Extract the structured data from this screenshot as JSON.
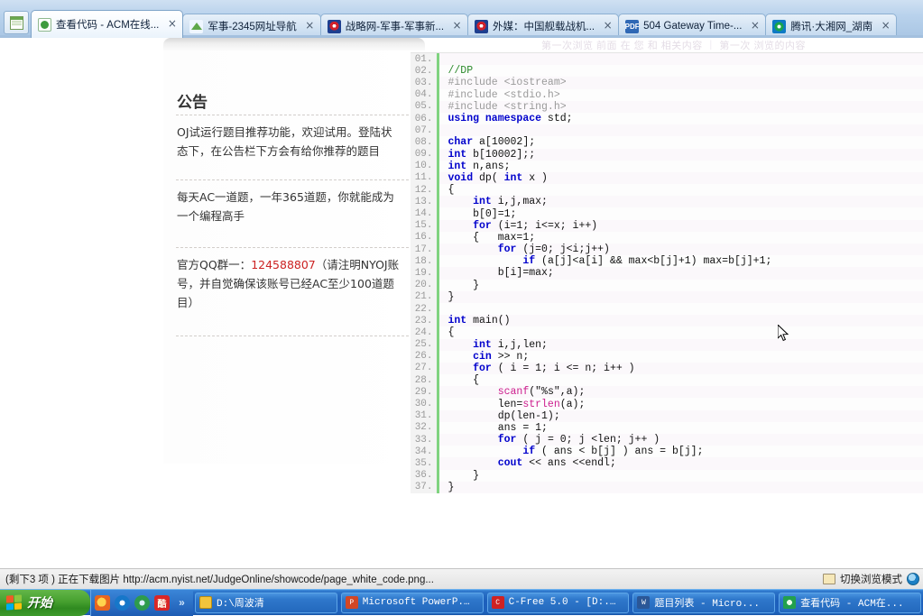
{
  "browser": {
    "window_icon": "window-restore-icon",
    "tabs": [
      {
        "label": "查看代码 - ACM在线...",
        "favicon": "acm-green-icon",
        "close": "×",
        "active": true
      },
      {
        "label": "军事-2345网址导航",
        "favicon": "2345-nav-icon",
        "close": "×",
        "active": false
      },
      {
        "label": "战略网-军事-军事新...",
        "favicon": "red-target-icon",
        "close": "×",
        "active": false
      },
      {
        "label": "外媒：中国舰载战机...",
        "favicon": "red-target-icon",
        "close": "×",
        "active": false
      },
      {
        "label": "504 Gateway Time-...",
        "favicon": "pdf-icon",
        "close": "×",
        "active": false
      },
      {
        "label": "腾讯·大湘网_湖南",
        "favicon": "qq-icon",
        "close": "×",
        "active": false
      }
    ]
  },
  "page": {
    "faint_header": "第一次浏览  前面 在 您 和 相关内容 ｜ 第一次 浏览的内容",
    "announcement": {
      "title": "公告",
      "blocks": [
        "OJ试运行题目推荐功能，欢迎试用。登陆状态下，在公告栏下方会有给你推荐的题目",
        "每天AC一道题，一年365道题，你就能成为一个编程高手"
      ],
      "qq_prefix": "官方QQ群一：",
      "qq_number": "124588807",
      "qq_suffix": "（请注明NYOJ账号，并自觉确保该账号已经AC至少100道题目）",
      "qq_number_color": "#cc2222"
    },
    "code_viewer": {
      "line_number_suffix": ".",
      "lines": [
        {
          "n": "01",
          "tokens": []
        },
        {
          "n": "02",
          "tokens": [
            {
              "t": "//DP",
              "c": "cm"
            }
          ]
        },
        {
          "n": "03",
          "tokens": [
            {
              "t": "#include <iostream>",
              "c": "pp"
            }
          ]
        },
        {
          "n": "04",
          "tokens": [
            {
              "t": "#include <stdio.h>",
              "c": "pp"
            }
          ]
        },
        {
          "n": "05",
          "tokens": [
            {
              "t": "#include <string.h>",
              "c": "pp"
            }
          ]
        },
        {
          "n": "06",
          "tokens": [
            {
              "t": "using namespace",
              "c": "k"
            },
            {
              "t": " std;",
              "c": ""
            }
          ]
        },
        {
          "n": "07",
          "tokens": []
        },
        {
          "n": "08",
          "tokens": [
            {
              "t": "char",
              "c": "k"
            },
            {
              "t": " a[10002];",
              "c": ""
            }
          ]
        },
        {
          "n": "09",
          "tokens": [
            {
              "t": "int",
              "c": "k"
            },
            {
              "t": " b[10002];;",
              "c": ""
            }
          ]
        },
        {
          "n": "10",
          "tokens": [
            {
              "t": "int",
              "c": "k"
            },
            {
              "t": " n,ans;",
              "c": ""
            }
          ]
        },
        {
          "n": "11",
          "tokens": [
            {
              "t": "void",
              "c": "k"
            },
            {
              "t": " dp( ",
              "c": ""
            },
            {
              "t": "int",
              "c": "k"
            },
            {
              "t": " x )",
              "c": ""
            }
          ]
        },
        {
          "n": "12",
          "tokens": [
            {
              "t": "{",
              "c": ""
            }
          ]
        },
        {
          "n": "13",
          "tokens": [
            {
              "t": "    ",
              "c": ""
            },
            {
              "t": "int",
              "c": "k"
            },
            {
              "t": " i,j,max;",
              "c": ""
            }
          ]
        },
        {
          "n": "14",
          "tokens": [
            {
              "t": "    b[0]=1;",
              "c": ""
            }
          ]
        },
        {
          "n": "15",
          "tokens": [
            {
              "t": "    ",
              "c": ""
            },
            {
              "t": "for",
              "c": "k"
            },
            {
              "t": " (i=1; i<=x; i++)",
              "c": ""
            }
          ]
        },
        {
          "n": "16",
          "tokens": [
            {
              "t": "    {   max=1;",
              "c": ""
            }
          ]
        },
        {
          "n": "17",
          "tokens": [
            {
              "t": "        ",
              "c": ""
            },
            {
              "t": "for",
              "c": "k"
            },
            {
              "t": " (j=0; j<i;j++)",
              "c": ""
            }
          ]
        },
        {
          "n": "18",
          "tokens": [
            {
              "t": "            ",
              "c": ""
            },
            {
              "t": "if",
              "c": "k"
            },
            {
              "t": " (a[j]<a[i] && max<b[j]+1) max=b[j]+1;",
              "c": ""
            }
          ]
        },
        {
          "n": "19",
          "tokens": [
            {
              "t": "        b[i]=max;",
              "c": ""
            }
          ]
        },
        {
          "n": "20",
          "tokens": [
            {
              "t": "    }",
              "c": ""
            }
          ]
        },
        {
          "n": "21",
          "tokens": [
            {
              "t": "}",
              "c": ""
            }
          ]
        },
        {
          "n": "22",
          "tokens": []
        },
        {
          "n": "23",
          "tokens": [
            {
              "t": "int",
              "c": "k"
            },
            {
              "t": " main()",
              "c": ""
            }
          ]
        },
        {
          "n": "24",
          "tokens": [
            {
              "t": "{",
              "c": ""
            }
          ]
        },
        {
          "n": "25",
          "tokens": [
            {
              "t": "    ",
              "c": ""
            },
            {
              "t": "int",
              "c": "k"
            },
            {
              "t": " i,j,len;",
              "c": ""
            }
          ]
        },
        {
          "n": "26",
          "tokens": [
            {
              "t": "    ",
              "c": ""
            },
            {
              "t": "cin",
              "c": "k"
            },
            {
              "t": " >> n;",
              "c": ""
            }
          ]
        },
        {
          "n": "27",
          "tokens": [
            {
              "t": "    ",
              "c": ""
            },
            {
              "t": "for",
              "c": "k"
            },
            {
              "t": " ( i = 1; i <= n; i++ )",
              "c": ""
            }
          ]
        },
        {
          "n": "28",
          "tokens": [
            {
              "t": "    {",
              "c": ""
            }
          ]
        },
        {
          "n": "29",
          "tokens": [
            {
              "t": "        ",
              "c": ""
            },
            {
              "t": "scanf",
              "c": "fn"
            },
            {
              "t": "(\"%s\",a);",
              "c": ""
            }
          ]
        },
        {
          "n": "30",
          "tokens": [
            {
              "t": "        len=",
              "c": ""
            },
            {
              "t": "strlen",
              "c": "fn"
            },
            {
              "t": "(a);",
              "c": ""
            }
          ]
        },
        {
          "n": "31",
          "tokens": [
            {
              "t": "        dp(len-1);",
              "c": ""
            }
          ]
        },
        {
          "n": "32",
          "tokens": [
            {
              "t": "        ans = 1;",
              "c": ""
            }
          ]
        },
        {
          "n": "33",
          "tokens": [
            {
              "t": "        ",
              "c": ""
            },
            {
              "t": "for",
              "c": "k"
            },
            {
              "t": " ( j = 0; j <len; j++ )",
              "c": ""
            }
          ]
        },
        {
          "n": "34",
          "tokens": [
            {
              "t": "            ",
              "c": ""
            },
            {
              "t": "if",
              "c": "k"
            },
            {
              "t": " ( ans < b[j] ) ans = b[j];",
              "c": ""
            }
          ]
        },
        {
          "n": "35",
          "tokens": [
            {
              "t": "        ",
              "c": ""
            },
            {
              "t": "cout",
              "c": "k"
            },
            {
              "t": " << ans <<endl;",
              "c": ""
            }
          ]
        },
        {
          "n": "36",
          "tokens": [
            {
              "t": "    }",
              "c": ""
            }
          ]
        },
        {
          "n": "37",
          "tokens": [
            {
              "t": "}",
              "c": ""
            }
          ]
        }
      ]
    }
  },
  "statusbar": {
    "text": "(剩下3 项 ) 正在下载图片 http://acm.nyist.net/JudgeOnline/showcode/page_white_code.png...",
    "browse_mode_label": "切换浏览模式",
    "browse_mode_icon": "window-icon",
    "globe_icon": "internet-zone-icon"
  },
  "taskbar": {
    "start_label": "开始",
    "quick_launch": [
      {
        "icon": "media-player-icon"
      },
      {
        "icon": "internet-explorer-icon"
      },
      {
        "icon": "green-browser-icon"
      },
      {
        "icon": "red-app-icon"
      },
      {
        "icon": "chevron-more-icon",
        "glyph": "»"
      }
    ],
    "items": [
      {
        "label": "D:\\周波清",
        "icon": "folder-icon"
      },
      {
        "label": "Microsoft PowerP...",
        "icon": "powerpoint-icon"
      },
      {
        "label": "C-Free 5.0 - [D:...",
        "icon": "cfree-icon"
      },
      {
        "label": "题目列表 - Micro...",
        "icon": "word-icon"
      },
      {
        "label": "查看代码 - ACM在...",
        "icon": "browser-icon"
      }
    ]
  }
}
